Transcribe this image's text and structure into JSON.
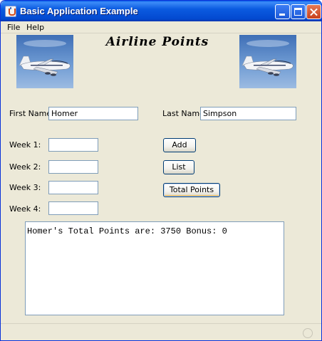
{
  "window": {
    "title": "Basic Application Example"
  },
  "menu": {
    "items": [
      "File",
      "Help"
    ]
  },
  "heading": "Airline Points",
  "form": {
    "first_name_label": "First Name:",
    "first_name_value": "Homer",
    "last_name_label": "Last Name:",
    "last_name_value": "Simpson",
    "weeks": [
      {
        "label": "Week 1:",
        "value": ""
      },
      {
        "label": "Week 2:",
        "value": ""
      },
      {
        "label": "Week 3:",
        "value": ""
      },
      {
        "label": "Week 4:",
        "value": ""
      }
    ]
  },
  "buttons": {
    "add": "Add",
    "list": "List",
    "total": "Total Points"
  },
  "output": {
    "text": "Homer's Total Points are: 3750 Bonus: 0"
  },
  "colors": {
    "titlebar": "#0a5fe8",
    "window_bg": "#ece9d8",
    "field_border": "#7f9db9"
  }
}
